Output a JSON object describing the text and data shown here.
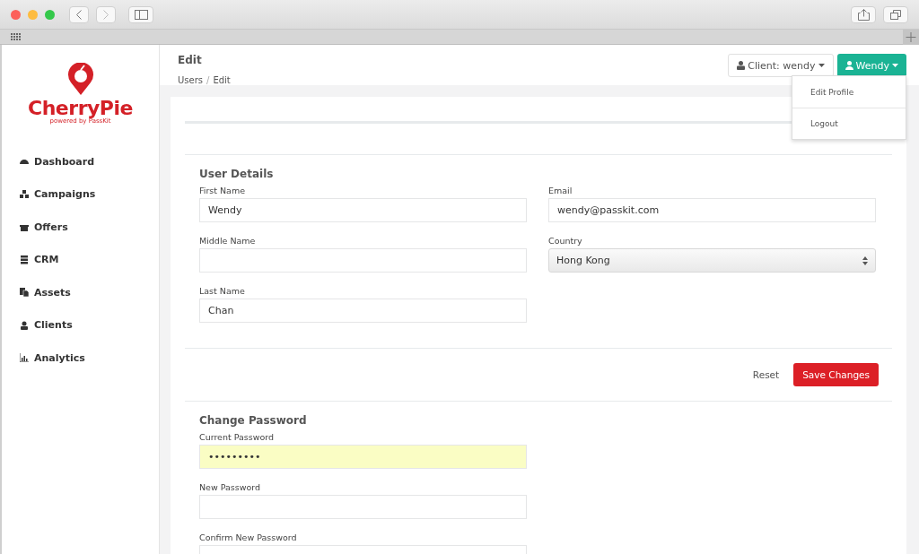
{
  "brand": {
    "name": "CherryPie",
    "tagline": "powered by PassKit"
  },
  "sidebar": {
    "items": [
      {
        "label": "Dashboard"
      },
      {
        "label": "Campaigns"
      },
      {
        "label": "Offers"
      },
      {
        "label": "CRM"
      },
      {
        "label": "Assets"
      },
      {
        "label": "Clients"
      },
      {
        "label": "Analytics"
      }
    ]
  },
  "header": {
    "title": "Edit",
    "breadcrumb": [
      "Users",
      "Edit"
    ],
    "separator": "/"
  },
  "client_button": {
    "label": "Client: wendy"
  },
  "user_menu": {
    "label": "Wendy",
    "expanded": true,
    "items": [
      "Edit Profile",
      "Logout"
    ]
  },
  "user_details": {
    "title": "User Details",
    "fields": [
      {
        "label": "First Name",
        "value": "Wendy",
        "kind": "text"
      },
      {
        "label": "Email",
        "value": "wendy@passkit.com",
        "kind": "text"
      },
      {
        "label": "Middle Name",
        "kind": "text"
      },
      {
        "label": "Country",
        "value": "Hong Kong",
        "kind": "select"
      },
      {
        "label": "Last Name",
        "value": "Chan",
        "kind": "text"
      }
    ]
  },
  "actions": {
    "reset": "Reset",
    "save": "Save Changes"
  },
  "change_password": {
    "title": "Change Password",
    "fields": [
      {
        "label": "Current Password",
        "value": "•••••••••",
        "autofilled": true
      },
      {
        "label": "New Password",
        "autofilled": false
      },
      {
        "label": "Confirm New Password",
        "autofilled": false
      }
    ]
  }
}
